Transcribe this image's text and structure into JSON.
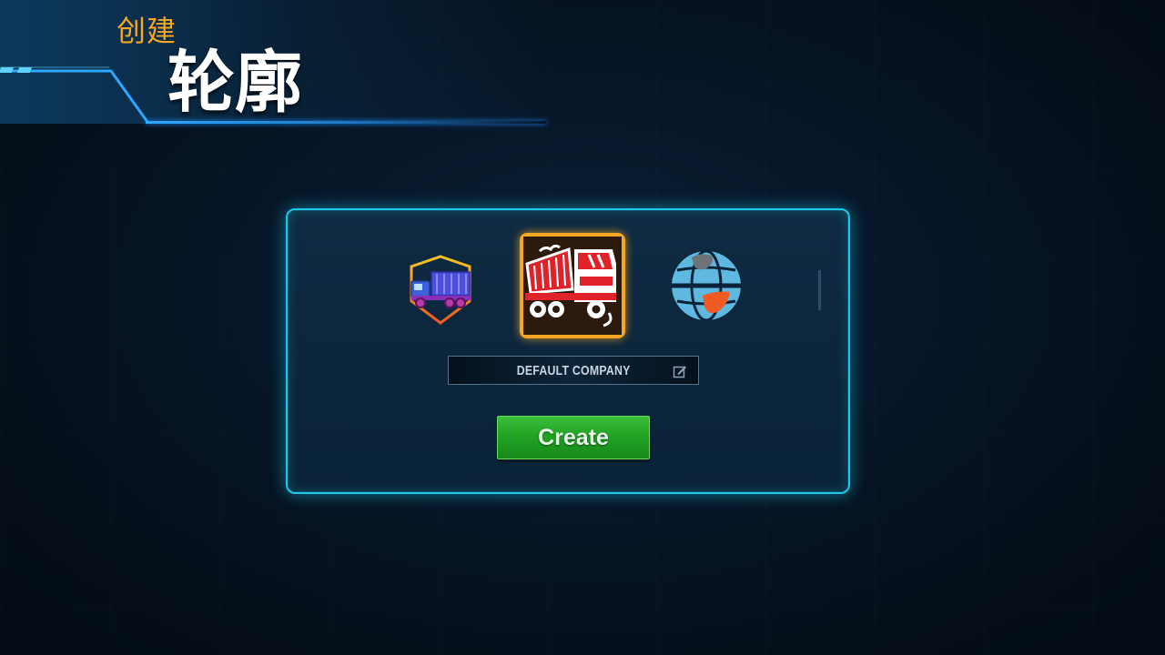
{
  "header": {
    "subtitle": "创建",
    "title": "轮廓"
  },
  "company": {
    "logos": [
      {
        "icon": "dump-truck-badge-icon",
        "selected": false
      },
      {
        "icon": "red-dump-truck-icon",
        "selected": true
      },
      {
        "icon": "globe-icon",
        "selected": false
      }
    ],
    "name_value": "DEFAULT COMPANY",
    "edit_icon": "edit-icon"
  },
  "actions": {
    "create_label": "Create"
  },
  "colors": {
    "accent_cyan": "#1ec7e8",
    "selection_orange": "#f5a623",
    "create_green": "#22a324",
    "subtitle_orange": "#f5a623"
  }
}
